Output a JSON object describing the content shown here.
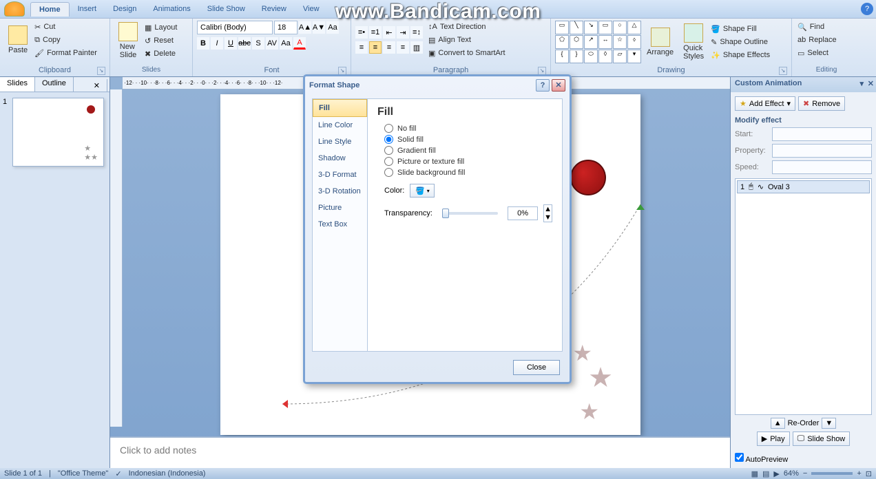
{
  "watermark": "www.Bandicam.com",
  "tabs": [
    "Home",
    "Insert",
    "Design",
    "Animations",
    "Slide Show",
    "Review",
    "View"
  ],
  "ribbon": {
    "clipboard": {
      "label": "Clipboard",
      "paste": "Paste",
      "cut": "Cut",
      "copy": "Copy",
      "fp": "Format Painter"
    },
    "slides": {
      "label": "Slides",
      "new": "New\nSlide",
      "layout": "Layout",
      "reset": "Reset",
      "delete": "Delete"
    },
    "font": {
      "label": "Font",
      "name": "Calibri (Body)",
      "size": "18"
    },
    "paragraph": {
      "label": "Paragraph",
      "dir": "Text Direction",
      "align": "Align Text",
      "smart": "Convert to SmartArt"
    },
    "drawing": {
      "label": "Drawing",
      "arrange": "Arrange",
      "quick": "Quick\nStyles",
      "fill": "Shape Fill",
      "outline": "Shape Outline",
      "effects": "Shape Effects"
    },
    "editing": {
      "label": "Editing",
      "find": "Find",
      "replace": "Replace",
      "select": "Select"
    }
  },
  "panes": {
    "slides": "Slides",
    "outline": "Outline"
  },
  "notes_placeholder": "Click to add notes",
  "anim": {
    "title": "Custom Animation",
    "add": "Add Effect",
    "remove": "Remove",
    "modify": "Modify effect",
    "start": "Start:",
    "property": "Property:",
    "speed": "Speed:",
    "list_item_num": "1",
    "list_item_name": "Oval 3",
    "reorder": "Re-Order",
    "play": "Play",
    "show": "Slide Show",
    "autoprev": "AutoPreview"
  },
  "dialog": {
    "title": "Format Shape",
    "cats": [
      "Fill",
      "Line Color",
      "Line Style",
      "Shadow",
      "3-D Format",
      "3-D Rotation",
      "Picture",
      "Text Box"
    ],
    "heading": "Fill",
    "opts": [
      "No fill",
      "Solid fill",
      "Gradient fill",
      "Picture or texture fill",
      "Slide background fill"
    ],
    "color": "Color:",
    "trans": "Transparency:",
    "trans_val": "0%",
    "close": "Close"
  },
  "status": {
    "slide": "Slide 1 of 1",
    "theme": "\"Office Theme\"",
    "lang": "Indonesian (Indonesia)",
    "zoom": "64%"
  }
}
